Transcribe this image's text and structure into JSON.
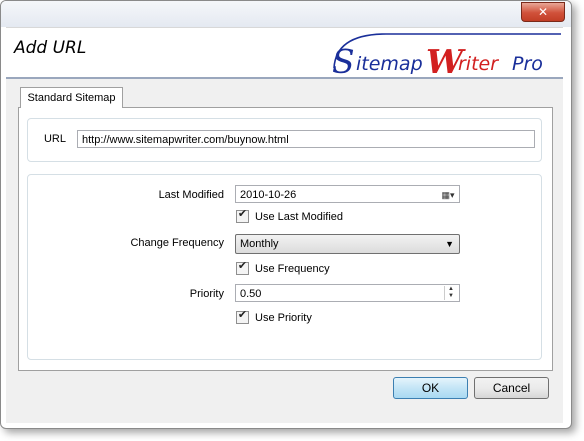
{
  "window": {
    "close_glyph": "✕"
  },
  "header": {
    "title": "Add URL",
    "logo": {
      "part1_initial": "S",
      "part1_rest": "itemap",
      "part2_initial": "W",
      "part2_rest": "riter",
      "part3": "Pro"
    },
    "colors": {
      "logo_blue": "#1a2f9a",
      "logo_red": "#d22020"
    }
  },
  "tab": {
    "label": "Standard Sitemap"
  },
  "url": {
    "label": "URL",
    "value": "http://www.sitemapwriter.com/buynow.html"
  },
  "last_modified": {
    "label": "Last Modified",
    "value": "2010-10-26",
    "calendar_icon": "calendar-icon",
    "checkbox_label": "Use Last Modified",
    "checked": true
  },
  "change_frequency": {
    "label": "Change Frequency",
    "value": "Monthly",
    "checkbox_label": "Use Frequency",
    "checked": true
  },
  "priority": {
    "label": "Priority",
    "value": "0.50",
    "checkbox_label": "Use Priority",
    "checked": true
  },
  "buttons": {
    "ok": "OK",
    "cancel": "Cancel"
  },
  "checkmark": "✔"
}
